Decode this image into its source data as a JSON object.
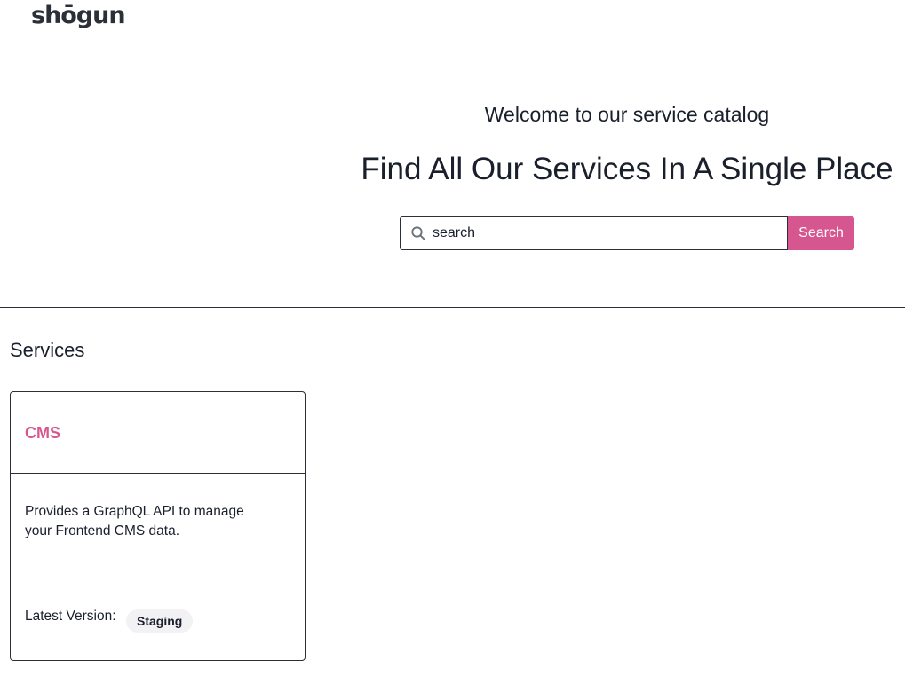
{
  "header": {
    "logo": "shōgun"
  },
  "hero": {
    "welcome": "Welcome to our service catalog",
    "headline": "Find All Our Services In A Single Place",
    "search": {
      "placeholder": "search",
      "value": "",
      "button_label": "Search"
    }
  },
  "services": {
    "title": "Services",
    "items": [
      {
        "name": "CMS",
        "description": " Provides a GraphQL API to manage your Frontend CMS data.",
        "version_label": "Latest Version:",
        "version": "Staging"
      }
    ]
  },
  "colors": {
    "accent": "#d6578f",
    "text": "#1a1f2c",
    "border": "#2b2f38",
    "badge_bg": "#f2f2f5"
  }
}
